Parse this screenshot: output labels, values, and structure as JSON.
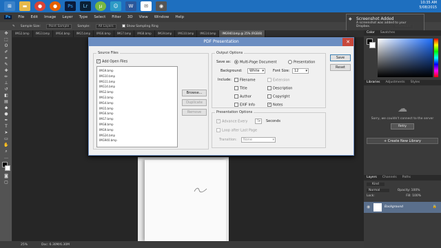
{
  "taskbar": {
    "icons": [
      "windows",
      "folder",
      "chrome",
      "firefox",
      "photoshop",
      "lightroom",
      "utorrent",
      "chat",
      "word",
      "mail",
      "camera"
    ],
    "time": "10:35 AM",
    "date": "5/08/2015"
  },
  "menu": [
    "Ps",
    "File",
    "Edit",
    "Image",
    "Layer",
    "Type",
    "Select",
    "Filter",
    "3D",
    "View",
    "Window",
    "Help"
  ],
  "options": {
    "sample_size_label": "Sample Size:",
    "sample_size_value": "Point Sample",
    "sample_label": "Sample:",
    "sample_value": "All Layers",
    "show_ring": "Show Sampling Ring",
    "essentials": "Essentials"
  },
  "tabs": [
    "IMG2.bmp",
    "IMG3.bmp",
    "IMG4.bmp",
    "IMG5.bmp",
    "IMG6.bmp",
    "IMG7.bmp",
    "IMG8.bmp",
    "IMG9.bmp",
    "IMG10.bmp",
    "IMG14.bmp",
    "IMG940.bmp @ 25% (RGB/8)"
  ],
  "toast": {
    "title": "Screenshot Added",
    "text": "A screenshot was added to your Dropbox."
  },
  "status": {
    "zoom": "25%",
    "doc": "Doc: 6.30M/6.30M"
  },
  "right_panel": {
    "color_tabs": [
      "Color",
      "Swatches"
    ],
    "lib_tabs": [
      "Libraries",
      "Adjustments",
      "Styles"
    ],
    "lib_message": "Sorry, we couldn't connect to the server",
    "retry": "Retry",
    "create_library": "+ Create New Library",
    "layer_tabs": [
      "Layers",
      "Channels",
      "Paths"
    ],
    "kind": "Kind",
    "blend": "Normal",
    "opacity_label": "Opacity:",
    "opacity": "100%",
    "lock_label": "Lock:",
    "fill_label": "Fill:",
    "fill": "100%",
    "layer_name": "Background"
  },
  "dialog": {
    "title": "PDF Presentation",
    "source_files": "Source Files",
    "add_open_files": "Add Open Files",
    "files": [
      "IMG9.bmp",
      "IMG10.bmp",
      "IMG11.bmp",
      "IMG14.bmp",
      "IMG2.bmp",
      "IMG3.bmp",
      "IMG4.bmp",
      "IMG5.bmp",
      "IMG6.bmp",
      "IMG7.bmp",
      "IMG8.bmp",
      "IMG9.bmp",
      "IMG24.bmp",
      "IMG940.bmp"
    ],
    "browse": "Browse...",
    "duplicate": "Duplicate",
    "remove": "Remove",
    "output_options": "Output Options",
    "save_as_label": "Save as:",
    "multi_page": "Multi-Page Document",
    "presentation": "Presentation",
    "background_label": "Background:",
    "background_value": "White",
    "font_size_label": "Font Size:",
    "font_size_value": "12",
    "include_label": "Include:",
    "include_items": [
      {
        "label": "Filename",
        "checked": false,
        "enabled": true
      },
      {
        "label": "Extension",
        "checked": false,
        "enabled": false
      },
      {
        "label": "Title",
        "checked": false,
        "enabled": true
      },
      {
        "label": "Description",
        "checked": false,
        "enabled": true
      },
      {
        "label": "Author",
        "checked": false,
        "enabled": true
      },
      {
        "label": "Copyright",
        "checked": false,
        "enabled": true
      },
      {
        "label": "EXIF Info",
        "checked": false,
        "enabled": true
      },
      {
        "label": "Notes",
        "checked": true,
        "enabled": true
      }
    ],
    "presentation_options": "Presentation Options",
    "advance_every": "Advance Every",
    "advance_value": "5",
    "seconds": "Seconds",
    "loop": "Loop after Last Page",
    "transition_label": "Transition:",
    "transition_value": "None",
    "save": "Save",
    "reset": "Reset"
  }
}
